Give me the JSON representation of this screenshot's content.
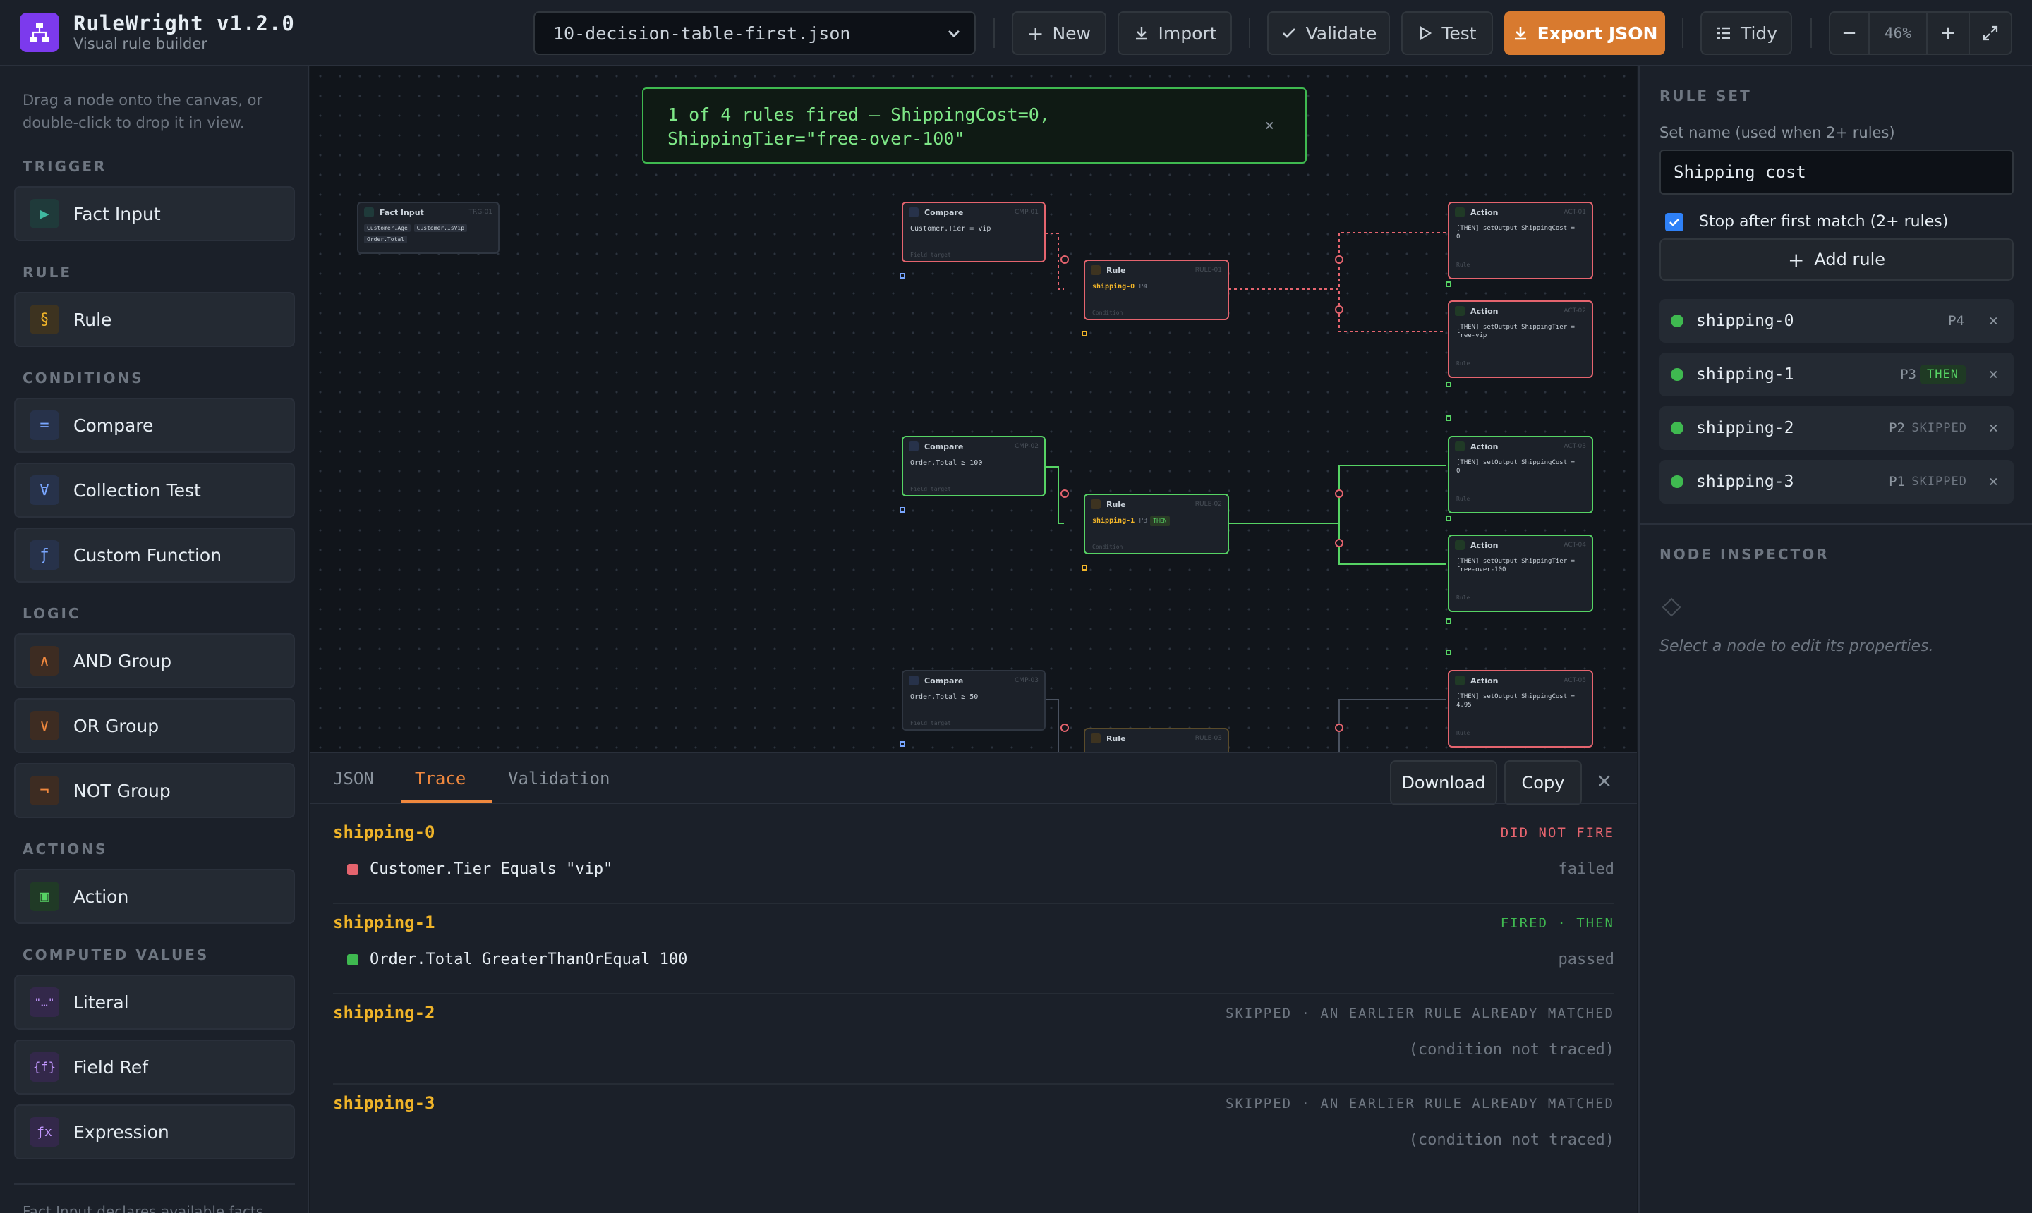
{
  "app": {
    "title": "RuleWright v1.2.0",
    "subtitle": "Visual rule builder"
  },
  "toolbar": {
    "file": "10-decision-table-first.json",
    "new_label": "New",
    "import_label": "Import",
    "validate_label": "Validate",
    "test_label": "Test",
    "export_label": "Export JSON",
    "tidy_label": "Tidy",
    "zoom": "46%",
    "zoom_out": "−",
    "zoom_in": "+"
  },
  "palette": {
    "hint": "Drag a node onto the canvas, or double-click to drop it in view.",
    "sections": {
      "trigger": "TRIGGER",
      "rule": "RULE",
      "conditions": "CONDITIONS",
      "logic": "LOGIC",
      "actions": "ACTIONS",
      "computed": "COMPUTED VALUES"
    },
    "items": {
      "fact_input": {
        "label": "Fact Input",
        "glyph": "▶"
      },
      "rule": {
        "label": "Rule",
        "glyph": "§"
      },
      "compare": {
        "label": "Compare",
        "glyph": "="
      },
      "collection_test": {
        "label": "Collection Test",
        "glyph": "∀"
      },
      "custom_function": {
        "label": "Custom Function",
        "glyph": "ƒ"
      },
      "and_group": {
        "label": "AND Group",
        "glyph": "∧"
      },
      "or_group": {
        "label": "OR Group",
        "glyph": "∨"
      },
      "not_group": {
        "label": "NOT Group",
        "glyph": "¬"
      },
      "action": {
        "label": "Action",
        "glyph": "▣"
      },
      "literal": {
        "label": "Literal",
        "glyph": "\"…\""
      },
      "field_ref": {
        "label": "Field Ref",
        "glyph": "{f}"
      },
      "expression": {
        "label": "Expression",
        "glyph": "ƒx"
      }
    },
    "footer": "Fact Input declares available facts"
  },
  "canvas": {
    "toast": {
      "line1": "1 of 4 rules fired — ShippingCost=0,",
      "line2": "ShippingTier=\"free-over-100\"",
      "close": "×"
    },
    "nodes": {
      "fact": {
        "title": "Fact Input",
        "id": "TRG-01",
        "chips": [
          "Customer.Age",
          "Customer.IsVip",
          "Order.Total"
        ]
      },
      "cmp1": {
        "title": "Compare",
        "id": "CMP-01",
        "expr": "Customer.Tier = vip",
        "foot": "Field target"
      },
      "cmp2": {
        "title": "Compare",
        "id": "CMP-02",
        "expr": "Order.Total ≥ 100",
        "foot": "Field target"
      },
      "cmp3": {
        "title": "Compare",
        "id": "CMP-03",
        "expr": "Order.Total ≥ 50",
        "foot": "Field target"
      },
      "rule0": {
        "title": "Rule",
        "id": "RULE-01",
        "name": "shipping-0",
        "pri": "P4",
        "foot": "Condition"
      },
      "rule1": {
        "title": "Rule",
        "id": "RULE-02",
        "name": "shipping-1",
        "pri": "P3",
        "tag": "THEN",
        "foot": "Condition"
      },
      "rule2": {
        "title": "Rule",
        "id": "RULE-03"
      },
      "act1": {
        "title": "Action",
        "id": "ACT-01",
        "l1": "[THEN] setOutput ShippingCost =",
        "l2": "0",
        "foot": "Rule"
      },
      "act2": {
        "title": "Action",
        "id": "ACT-02",
        "l1": "[THEN] setOutput ShippingTier =",
        "l2": "free-vip",
        "foot": "Rule"
      },
      "act3": {
        "title": "Action",
        "id": "ACT-03",
        "l1": "[THEN] setOutput ShippingCost =",
        "l2": "0",
        "foot": "Rule"
      },
      "act4": {
        "title": "Action",
        "id": "ACT-04",
        "l1": "[THEN] setOutput ShippingTier =",
        "l2": "free-over-100",
        "foot": "Rule"
      },
      "act5": {
        "title": "Action",
        "id": "ACT-05",
        "l1": "[THEN] setOutput ShippingCost =",
        "l2": "4.95",
        "foot": "Rule"
      }
    }
  },
  "bottom": {
    "tabs": [
      "JSON",
      "Trace",
      "Validation"
    ],
    "active_tab": "Trace",
    "download_label": "Download",
    "copy_label": "Copy",
    "close": "×",
    "trace": [
      {
        "name": "shipping-0",
        "status": "DID NOT FIRE",
        "cond": "Customer.Tier Equals \"vip\"",
        "result": "failed"
      },
      {
        "name": "shipping-1",
        "status": "FIRED · THEN",
        "cond": "Order.Total GreaterThanOrEqual 100",
        "result": "passed"
      },
      {
        "name": "shipping-2",
        "status": "SKIPPED · AN EARLIER RULE ALREADY MATCHED",
        "note": "(condition not traced)"
      },
      {
        "name": "shipping-3",
        "status": "SKIPPED · AN EARLIER RULE ALREADY MATCHED",
        "note": "(condition not traced)"
      }
    ]
  },
  "rule_set": {
    "heading": "RULE SET",
    "name_label": "Set name (used when 2+ rules)",
    "name_value": "Shipping cost",
    "stop_label": "Stop after first match (2+ rules)",
    "stop_checked": true,
    "add_rule_label": "Add rule",
    "rules": [
      {
        "name": "shipping-0",
        "priority": "P4",
        "badge": "",
        "remove": "×"
      },
      {
        "name": "shipping-1",
        "priority": "P3",
        "badge": "THEN",
        "remove": "×"
      },
      {
        "name": "shipping-2",
        "priority": "P2",
        "badge": "SKIPPED",
        "remove": "×"
      },
      {
        "name": "shipping-3",
        "priority": "P1",
        "badge": "SKIPPED",
        "remove": "×"
      }
    ]
  },
  "inspector": {
    "heading": "NODE INSPECTOR",
    "empty": "Select a node to edit its properties."
  }
}
